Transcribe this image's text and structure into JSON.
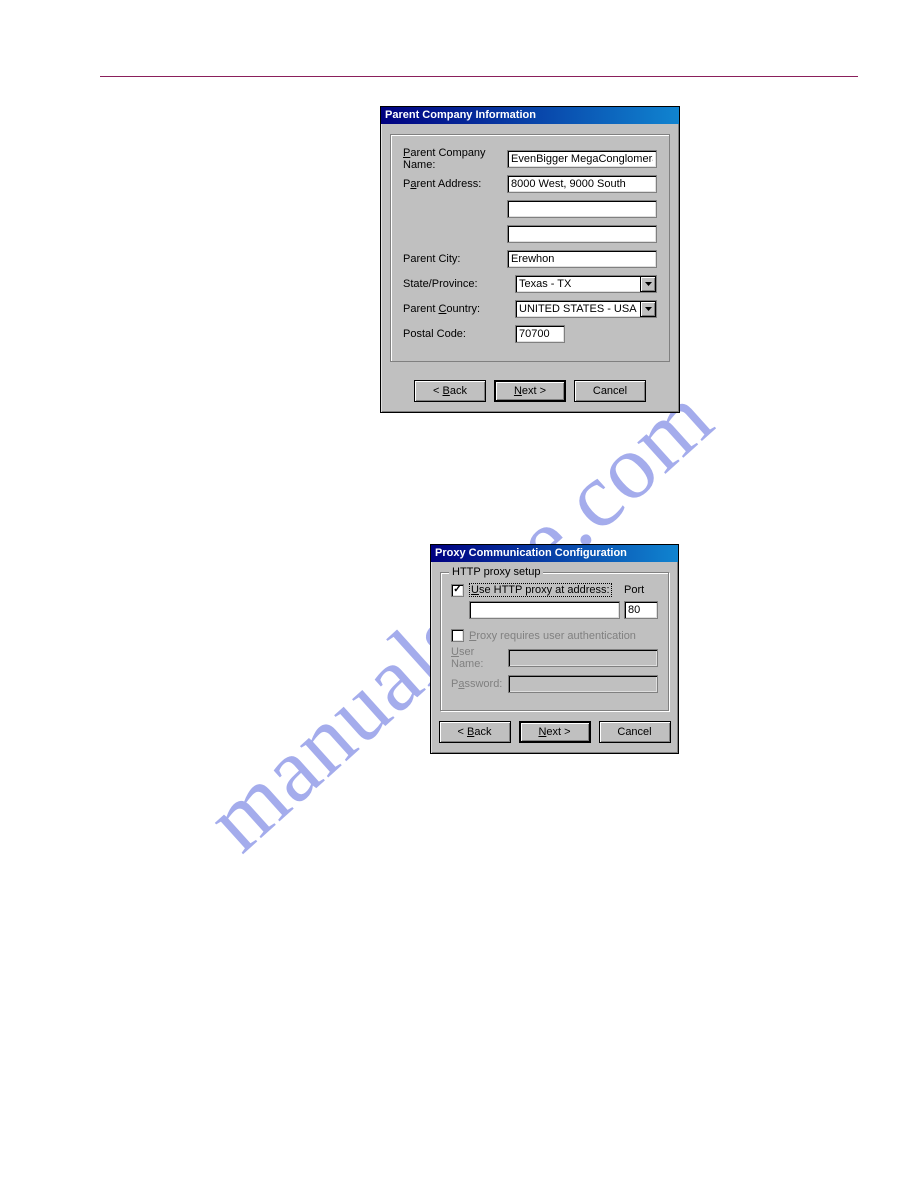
{
  "watermark": "manualslive.com",
  "dialog1": {
    "title": "Parent Company Information",
    "labels": {
      "company_name": "Parent Company Name:",
      "address": "Parent Address:",
      "city": "Parent City:",
      "state": "State/Province:",
      "country": "Parent Country:",
      "postal": "Postal Code:"
    },
    "values": {
      "company_name": "EvenBigger MegaConglomerate, Inc.",
      "address1": "8000 West, 9000 South",
      "address2": "",
      "address3": "",
      "city": "Erewhon",
      "state": "Texas - TX",
      "country": "UNITED STATES - USA",
      "postal": "70700"
    },
    "buttons": {
      "back": "< Back",
      "next": "Next >",
      "cancel": "Cancel"
    }
  },
  "dialog2": {
    "title": "Proxy Communication Configuration",
    "group_title": "HTTP proxy setup",
    "use_proxy_label": "Use HTTP proxy at address:",
    "port_label": "Port",
    "port_value": "80",
    "address_value": "",
    "auth_required_label": "Proxy requires user authentication",
    "user_label": "User Name:",
    "pass_label": "Password:",
    "user_value": "",
    "pass_value": "",
    "buttons": {
      "back": "< Back",
      "next": "Next >",
      "cancel": "Cancel"
    }
  }
}
